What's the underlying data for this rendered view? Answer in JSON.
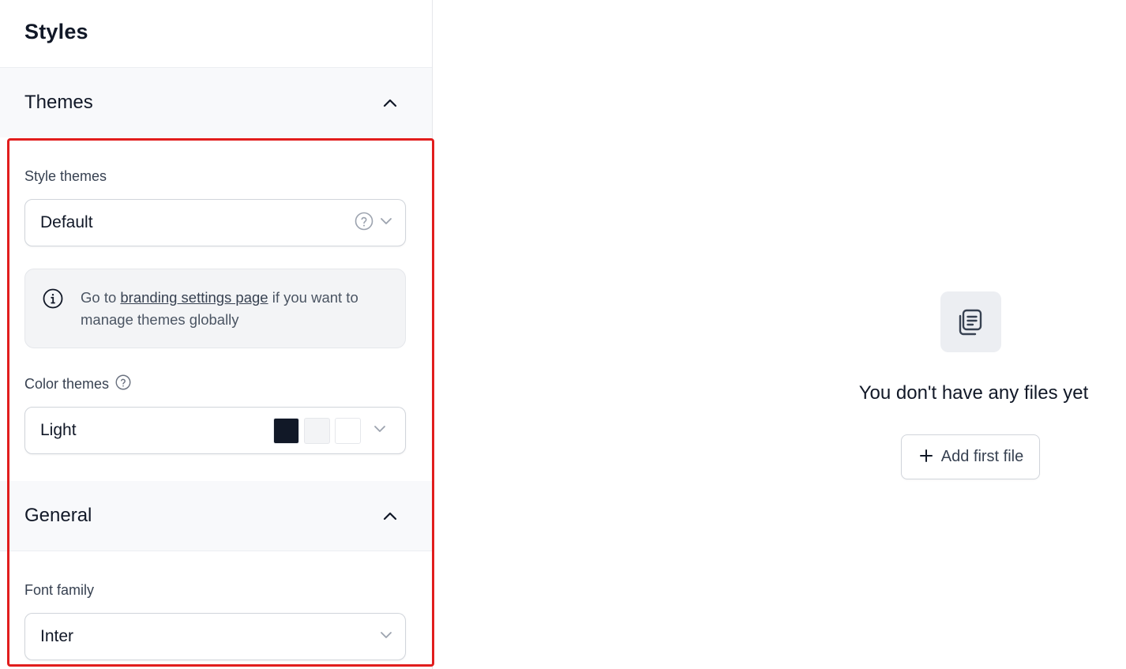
{
  "panel": {
    "title": "Styles"
  },
  "themes": {
    "title": "Themes",
    "style_themes": {
      "label": "Style themes",
      "value": "Default"
    },
    "info": {
      "prefix": "Go to ",
      "link": "branding settings page",
      "suffix": " if you want to manage themes globally"
    },
    "color_themes": {
      "label": "Color themes",
      "value": "Light",
      "swatches": [
        "#111827",
        "#f3f4f6",
        "#ffffff"
      ]
    }
  },
  "general": {
    "title": "General",
    "font_family": {
      "label": "Font family",
      "value": "Inter"
    }
  },
  "main": {
    "empty_text": "You don't have any files yet",
    "add_button_label": "Add first file"
  },
  "colors": {
    "highlight": "#e11d1d",
    "text_primary": "#111827",
    "text_secondary": "#374151"
  }
}
